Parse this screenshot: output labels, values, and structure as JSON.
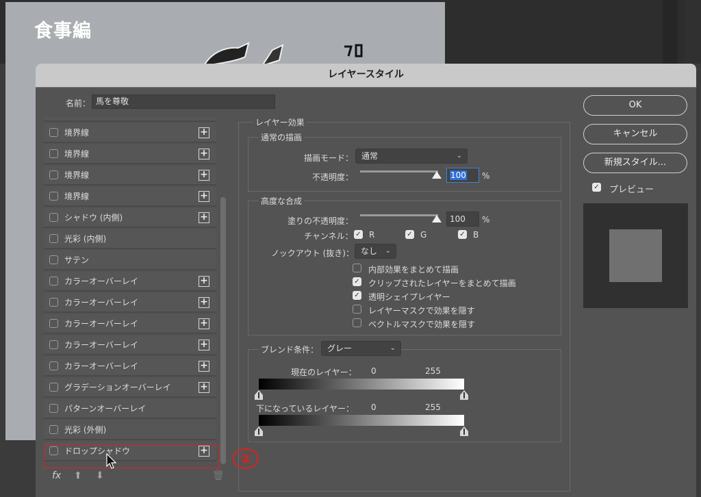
{
  "document": {
    "title": "食事編"
  },
  "dialog": {
    "title": "レイヤースタイル",
    "name_label": "名前：",
    "name_value": "馬を尊敬"
  },
  "style_list": {
    "items": [
      {
        "label": "境界線",
        "checked": false,
        "has_plus": true
      },
      {
        "label": "境界線",
        "checked": false,
        "has_plus": true
      },
      {
        "label": "境界線",
        "checked": false,
        "has_plus": true
      },
      {
        "label": "境界線",
        "checked": false,
        "has_plus": true
      },
      {
        "label": "シャドウ (内側)",
        "checked": false,
        "has_plus": true
      },
      {
        "label": "光彩 (内側)",
        "checked": false,
        "has_plus": false
      },
      {
        "label": "サテン",
        "checked": false,
        "has_plus": false
      },
      {
        "label": "カラーオーバーレイ",
        "checked": false,
        "has_plus": true
      },
      {
        "label": "カラーオーバーレイ",
        "checked": false,
        "has_plus": true
      },
      {
        "label": "カラーオーバーレイ",
        "checked": false,
        "has_plus": true
      },
      {
        "label": "カラーオーバーレイ",
        "checked": false,
        "has_plus": true
      },
      {
        "label": "カラーオーバーレイ",
        "checked": false,
        "has_plus": true
      },
      {
        "label": "グラデーションオーバーレイ",
        "checked": false,
        "has_plus": true
      },
      {
        "label": "パターンオーバーレイ",
        "checked": false,
        "has_plus": false
      },
      {
        "label": "光彩 (外側)",
        "checked": false,
        "has_plus": false
      },
      {
        "label": "ドロップシャドウ",
        "checked": false,
        "has_plus": true
      }
    ],
    "tools": {
      "fx": "fx",
      "plus": "+"
    }
  },
  "effects": {
    "group_title": "レイヤー効果",
    "normal": {
      "title": "通常の描画",
      "blend_mode_label": "描画モード：",
      "blend_mode_value": "通常",
      "opacity_label": "不透明度：",
      "opacity_value": "100",
      "unit": "%"
    },
    "advanced": {
      "title": "高度な合成",
      "fill_opacity_label": "塗りの不透明度：",
      "fill_opacity_value": "100",
      "unit": "%",
      "channels_label": "チャンネル：",
      "channels": [
        {
          "label": "R",
          "checked": true
        },
        {
          "label": "G",
          "checked": true
        },
        {
          "label": "B",
          "checked": true
        }
      ],
      "knockout_label": "ノックアウト (抜き)：",
      "knockout_value": "なし",
      "options": [
        {
          "label": "内部効果をまとめて描画",
          "checked": false
        },
        {
          "label": "クリップされたレイヤーをまとめて描画",
          "checked": true
        },
        {
          "label": "透明シェイプレイヤー",
          "checked": true
        },
        {
          "label": "レイヤーマスクで効果を隠す",
          "checked": false
        },
        {
          "label": "ベクトルマスクで効果を隠す",
          "checked": false
        }
      ]
    },
    "blend_if": {
      "title": "ブレンド条件：",
      "value": "グレー",
      "this_layer_label": "現在のレイヤー：",
      "this_layer_min": "0",
      "this_layer_max": "255",
      "underlying_label": "下になっているレイヤー：",
      "underlying_min": "0",
      "underlying_max": "255"
    }
  },
  "buttons": {
    "ok": "OK",
    "cancel": "キャンセル",
    "new_style": "新規スタイル...",
    "preview_label": "プレビュー",
    "preview_checked": true
  },
  "annotation": {
    "step": "②"
  }
}
